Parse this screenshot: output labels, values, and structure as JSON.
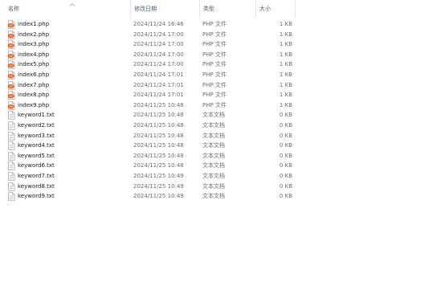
{
  "columns": {
    "name": "名称",
    "date": "修改日期",
    "type": "类型",
    "size": "大小"
  },
  "sort": {
    "column": "name",
    "direction": "ascending",
    "icon": "chevron-up-icon"
  },
  "files": [
    {
      "name": "index1.php",
      "date": "2024/11/24 16:46",
      "type": "PHP 文件",
      "size": "1 KB",
      "icon": "php-file-icon"
    },
    {
      "name": "index2.php",
      "date": "2024/11/24 17:00",
      "type": "PHP 文件",
      "size": "1 KB",
      "icon": "php-file-icon"
    },
    {
      "name": "index3.php",
      "date": "2024/11/24 17:00",
      "type": "PHP 文件",
      "size": "1 KB",
      "icon": "php-file-icon"
    },
    {
      "name": "index4.php",
      "date": "2024/11/24 17:00",
      "type": "PHP 文件",
      "size": "1 KB",
      "icon": "php-file-icon"
    },
    {
      "name": "index5.php",
      "date": "2024/11/24 17:00",
      "type": "PHP 文件",
      "size": "1 KB",
      "icon": "php-file-icon"
    },
    {
      "name": "index6.php",
      "date": "2024/11/24 17:01",
      "type": "PHP 文件",
      "size": "1 KB",
      "icon": "php-file-icon"
    },
    {
      "name": "index7.php",
      "date": "2024/11/24 17:01",
      "type": "PHP 文件",
      "size": "1 KB",
      "icon": "php-file-icon"
    },
    {
      "name": "index8.php",
      "date": "2024/11/24 17:01",
      "type": "PHP 文件",
      "size": "1 KB",
      "icon": "php-file-icon"
    },
    {
      "name": "index9.php",
      "date": "2024/11/25 10:48",
      "type": "PHP 文件",
      "size": "1 KB",
      "icon": "php-file-icon"
    },
    {
      "name": "keyword1.txt",
      "date": "2024/11/25 10:48",
      "type": "文本文档",
      "size": "0 KB",
      "icon": "text-file-icon"
    },
    {
      "name": "keyword2.txt",
      "date": "2024/11/25 10:48",
      "type": "文本文档",
      "size": "0 KB",
      "icon": "text-file-icon"
    },
    {
      "name": "keyword3.txt",
      "date": "2024/11/25 10:48",
      "type": "文本文档",
      "size": "0 KB",
      "icon": "text-file-icon"
    },
    {
      "name": "keyword4.txt",
      "date": "2024/11/25 10:48",
      "type": "文本文档",
      "size": "0 KB",
      "icon": "text-file-icon"
    },
    {
      "name": "keyword5.txt",
      "date": "2024/11/25 10:48",
      "type": "文本文档",
      "size": "0 KB",
      "icon": "text-file-icon"
    },
    {
      "name": "keyword6.txt",
      "date": "2024/11/25 10:48",
      "type": "文本文档",
      "size": "0 KB",
      "icon": "text-file-icon"
    },
    {
      "name": "keyword7.txt",
      "date": "2024/11/25 10:49",
      "type": "文本文档",
      "size": "0 KB",
      "icon": "text-file-icon"
    },
    {
      "name": "keyword8.txt",
      "date": "2024/11/25 10:49",
      "type": "文本文档",
      "size": "0 KB",
      "icon": "text-file-icon"
    },
    {
      "name": "keyword9.txt",
      "date": "2024/11/25 10:49",
      "type": "文本文档",
      "size": "0 KB",
      "icon": "text-file-icon"
    }
  ]
}
